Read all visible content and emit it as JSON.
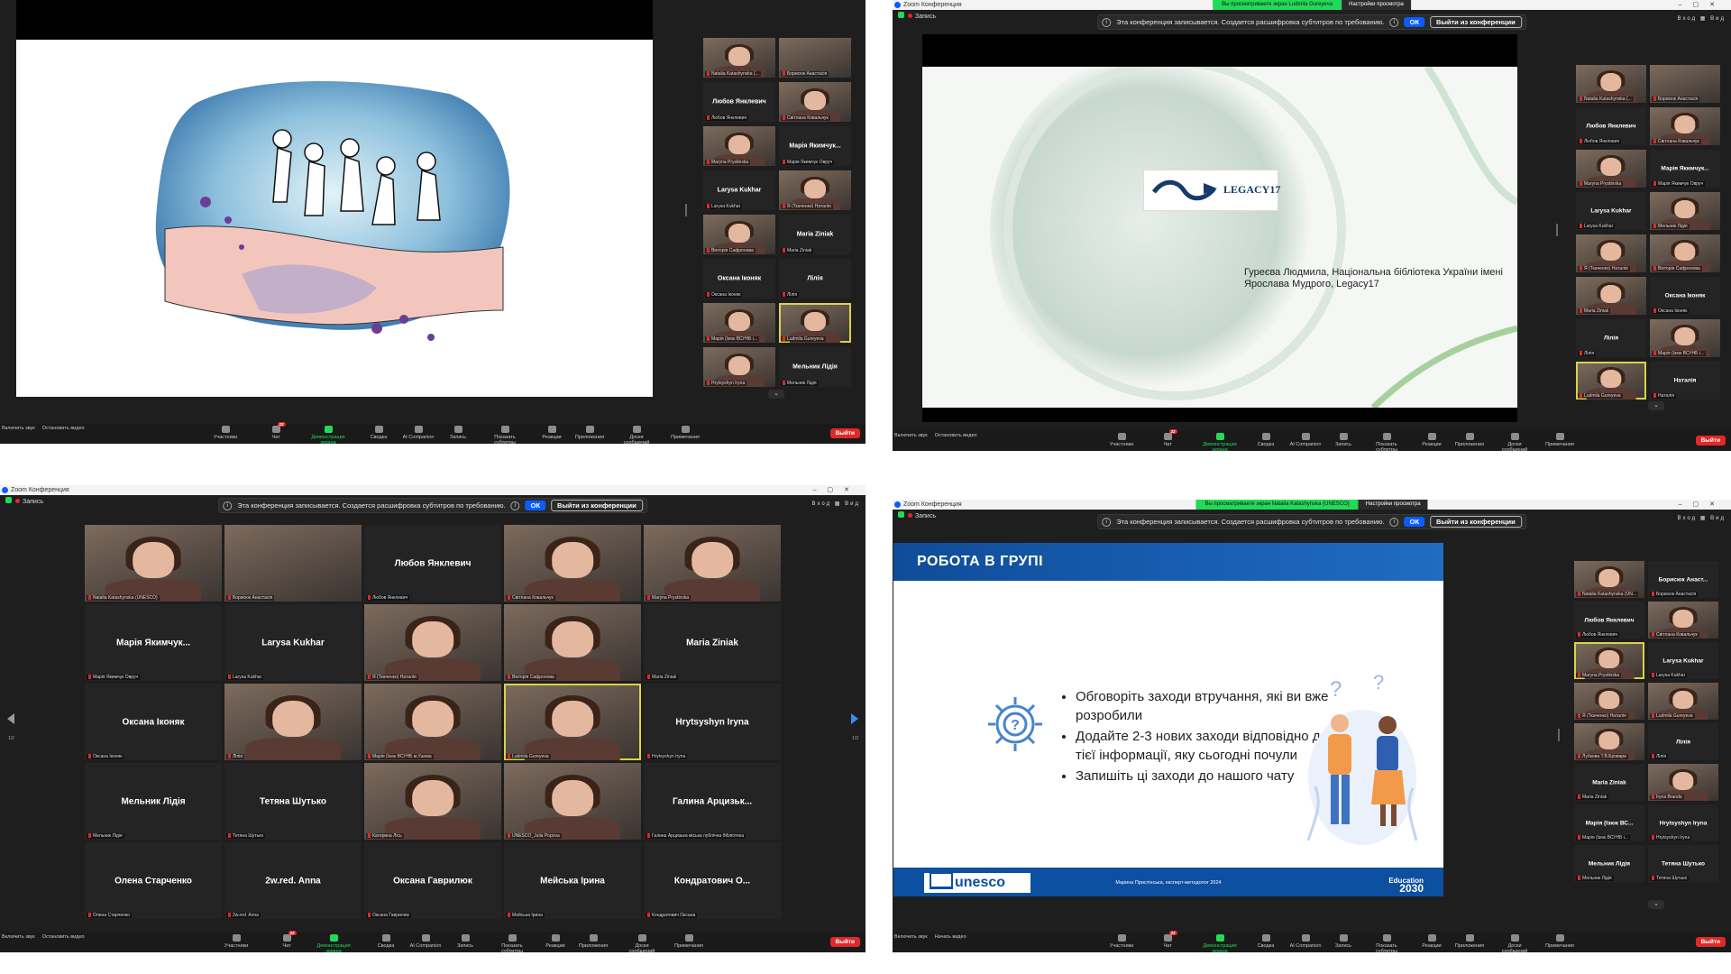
{
  "common": {
    "app_title": "Zoom Конференция",
    "recording_label": "Запись",
    "notice_text": "Эта конференция записывается. Создается расшифровка субтитров по требованию.",
    "ok_label": "ОК",
    "leave_meeting_label": "Выйти из конференции",
    "view_label": "Вид",
    "enter_label": "Вход",
    "viewing_options": "Настройки просмотра",
    "leave_button": "Выйти",
    "toolbar": {
      "mute": "Включить звук",
      "stop_video": "Остановить видео",
      "start_video": "Начать видео",
      "participants": "Участники",
      "chat": "Чат",
      "share": "Демонстрация экрана",
      "summary": "Сводка",
      "companion": "AI Companion",
      "record": "Запись",
      "captions": "Показать субтитры",
      "reactions": "Реакции",
      "apps": "Приложения",
      "whiteboard": "Доски сообщений",
      "notes": "Примечания"
    },
    "icons": [
      "mic-muted-icon",
      "video-icon",
      "participants-icon",
      "chat-icon",
      "share-screen-icon",
      "summary-icon",
      "ai-companion-icon",
      "record-icon",
      "captions-icon",
      "reactions-icon",
      "apps-icon",
      "whiteboard-icon",
      "notes-icon"
    ]
  },
  "q1": {
    "participants_count": "41",
    "chat_badge": "22",
    "tiles": [
      {
        "video": true,
        "caption": "Natalia Katashynska (..."
      },
      {
        "video": true,
        "books": true,
        "caption": "Борисюк Анастасія"
      },
      {
        "name": "Любов Янклевич",
        "caption": "Любов Янклевич"
      },
      {
        "video": true,
        "caption": "Світлана Ковальчук"
      },
      {
        "video": true,
        "caption": "Maryna Prystinska"
      },
      {
        "name": "Марія Якимчук...",
        "caption": "Марія Якимчук Овруч"
      },
      {
        "name": "Larysa Kukhar",
        "caption": "Larysa Kukhar"
      },
      {
        "video": true,
        "caption": "Я (Ткаченко) Наталія"
      },
      {
        "video": true,
        "caption": "Вікторія Сафронова"
      },
      {
        "name": "Maria Ziniak",
        "caption": "Maria Ziniak"
      },
      {
        "name": "Оксана Іконяк",
        "caption": "Оксана Іконяк"
      },
      {
        "name": "Лілія",
        "caption": "Лілія"
      },
      {
        "video": true,
        "caption": "Марія (Ізюк ВСУНБ і..."
      },
      {
        "video": true,
        "highlight": true,
        "caption": "Ludmila Gureyeva"
      },
      {
        "video": true,
        "caption": "Hrytsyshyn Iryna"
      },
      {
        "name": "Мельник Лідія",
        "caption": "Мельник Лідія"
      }
    ]
  },
  "q2": {
    "share_banner": "Вы просматриваете экран Ludmila Gureyeva",
    "participants_count": "42",
    "chat_badge": "22",
    "slide_logo": "LEGACY17",
    "slide_caption": "Гуреєва Людмила, Національна бібліотека України імені Ярослава Мудрого, Legacy17",
    "tiles": [
      {
        "video": true,
        "caption": "Natalia Katashynska (..."
      },
      {
        "video": true,
        "books": true,
        "caption": "Борисюк Анастасія"
      },
      {
        "name": "Любов Янклевич",
        "caption": "Любов Янклевич"
      },
      {
        "video": true,
        "caption": "Світлана Ковальчук"
      },
      {
        "video": true,
        "caption": "Maryna Prystinska"
      },
      {
        "name": "Марія Якимчук...",
        "caption": "Марія Якимчук Овруч"
      },
      {
        "name": "Larysa Kukhar",
        "caption": "Larysa Kukhar"
      },
      {
        "video": true,
        "caption": "Мельник Лідія"
      },
      {
        "video": true,
        "caption": "Я (Ткаченко) Наталія"
      },
      {
        "video": true,
        "caption": "Вікторія Сафронова"
      },
      {
        "video": true,
        "caption": "Maria Ziniak"
      },
      {
        "name": "Оксана Іконяк",
        "caption": "Оксана Іконяк"
      },
      {
        "name": "Лілія",
        "caption": "Лілія"
      },
      {
        "video": true,
        "caption": "Марія (Ізюк ВСУНБ і..."
      },
      {
        "video": true,
        "highlight": true,
        "caption": "Ludmila Gureyeva"
      },
      {
        "name": "Наталія",
        "caption": "Наталія"
      }
    ]
  },
  "q3": {
    "participants_count": "41",
    "chat_badge": "22",
    "page_left": "1/2",
    "page_right": "1/2",
    "tiles": [
      {
        "video": true,
        "caption": "Natalia Katashynska (UNESCO)"
      },
      {
        "video": true,
        "books": true,
        "caption": "Борисюк Анастасія"
      },
      {
        "name": "Любов Янклевич",
        "caption": "Любов Янклевич"
      },
      {
        "video": true,
        "caption": "Світлана Ковальчук"
      },
      {
        "video": true,
        "caption": "Maryna Prystinska"
      },
      {
        "name": "Марія Якимчук...",
        "caption": "Марія Якимчук Овруч"
      },
      {
        "name": "Larysa Kukhar",
        "caption": "Larysa Kukhar"
      },
      {
        "video": true,
        "caption": "Я (Ткаченко) Наталія"
      },
      {
        "video": true,
        "caption": "Вікторія Сафронова"
      },
      {
        "name": "Maria Ziniak",
        "caption": "Maria Ziniak"
      },
      {
        "name": "Оксана Іконяк",
        "caption": "Оксана Іконяк"
      },
      {
        "video": true,
        "caption": "Лілія"
      },
      {
        "video": true,
        "caption": "Марія (Ізюк ВСУНБ м.Ушова"
      },
      {
        "video": true,
        "highlight": true,
        "caption": "Ludmila Gureyeva"
      },
      {
        "name": "Hrytsyshyn Iryna",
        "caption": "Hrytsyshyn Iryna"
      },
      {
        "name": "Мельник Лідія",
        "caption": "Мельник Лідія"
      },
      {
        "name": "Тетяна Шутько",
        "caption": "Тетяна Шутько"
      },
      {
        "video": true,
        "caption": "Катерина Лісь"
      },
      {
        "video": true,
        "caption": "UNESCO_Julia Popova"
      },
      {
        "name": "Галина Арцизьк...",
        "caption": "Галина Арцизька міська публічна бібліотека"
      },
      {
        "name": "Олена Старченко",
        "caption": "Олена Старченко"
      },
      {
        "name": "2w.red. Anna",
        "caption": "2w.red. Anna"
      },
      {
        "name": "Оксана Гаврилюк",
        "caption": "Оксана Гаврилюк"
      },
      {
        "name": "Мейська Ірина",
        "caption": "Мейська Ірина"
      },
      {
        "name": "Кондратович О...",
        "caption": "Кондратович Оксана"
      }
    ]
  },
  "q4": {
    "share_banner": "Вы просматриваете экран Natalia Katashynska (UNESCO)",
    "participants_count": "39",
    "chat_badge": "22",
    "slide_title": "РОБОТА В ГРУПІ",
    "bullets": [
      "Обговоріть заходи втручання, які ви вже розробили",
      "Додайте 2-3 нових заходи відповідно до тієї інформації, яку сьогодні почули",
      "Запишіть ці заходи до нашого чату"
    ],
    "footer_brand": "unesco",
    "footer_author": "Марина Пристінська, експерт-методолог 2024",
    "education_label": "Education",
    "education_year": "2030",
    "tiles": [
      {
        "video": true,
        "caption": "Natalia Katashynska (UN..."
      },
      {
        "name": "Борисюк Анаст...",
        "caption": "Борисюк Анастасія"
      },
      {
        "name": "Любов Янклевич",
        "caption": "Любов Янклевич"
      },
      {
        "video": true,
        "caption": "Світлана Ковальчук"
      },
      {
        "video": true,
        "highlight": true,
        "caption": "Maryna Prystinska"
      },
      {
        "name": "Larysa Kukhar",
        "caption": "Larysa Kukhar"
      },
      {
        "video": true,
        "caption": "Я (Ткаченко) Наталія"
      },
      {
        "video": true,
        "caption": "Ludmila Gureyeva"
      },
      {
        "video": true,
        "caption": "Лубкова Т.В.Бровари"
      },
      {
        "name": "Лілія",
        "caption": "Лілія"
      },
      {
        "name": "Maria Ziniak",
        "caption": "Maria Ziniak"
      },
      {
        "video": true,
        "caption": "Iryna Branda"
      },
      {
        "name": "Марія (Ізюк ВС...",
        "caption": "Марія (Ізюк ВСУНБ і..."
      },
      {
        "name": "Hrytsyshyn Iryna",
        "caption": "Hrytsyshyn Iryna"
      },
      {
        "name": "Мельник Лідія",
        "caption": "Мельник Лідія"
      },
      {
        "name": "Тетяна Шутько",
        "caption": "Тетяна Шутько"
      }
    ]
  }
}
